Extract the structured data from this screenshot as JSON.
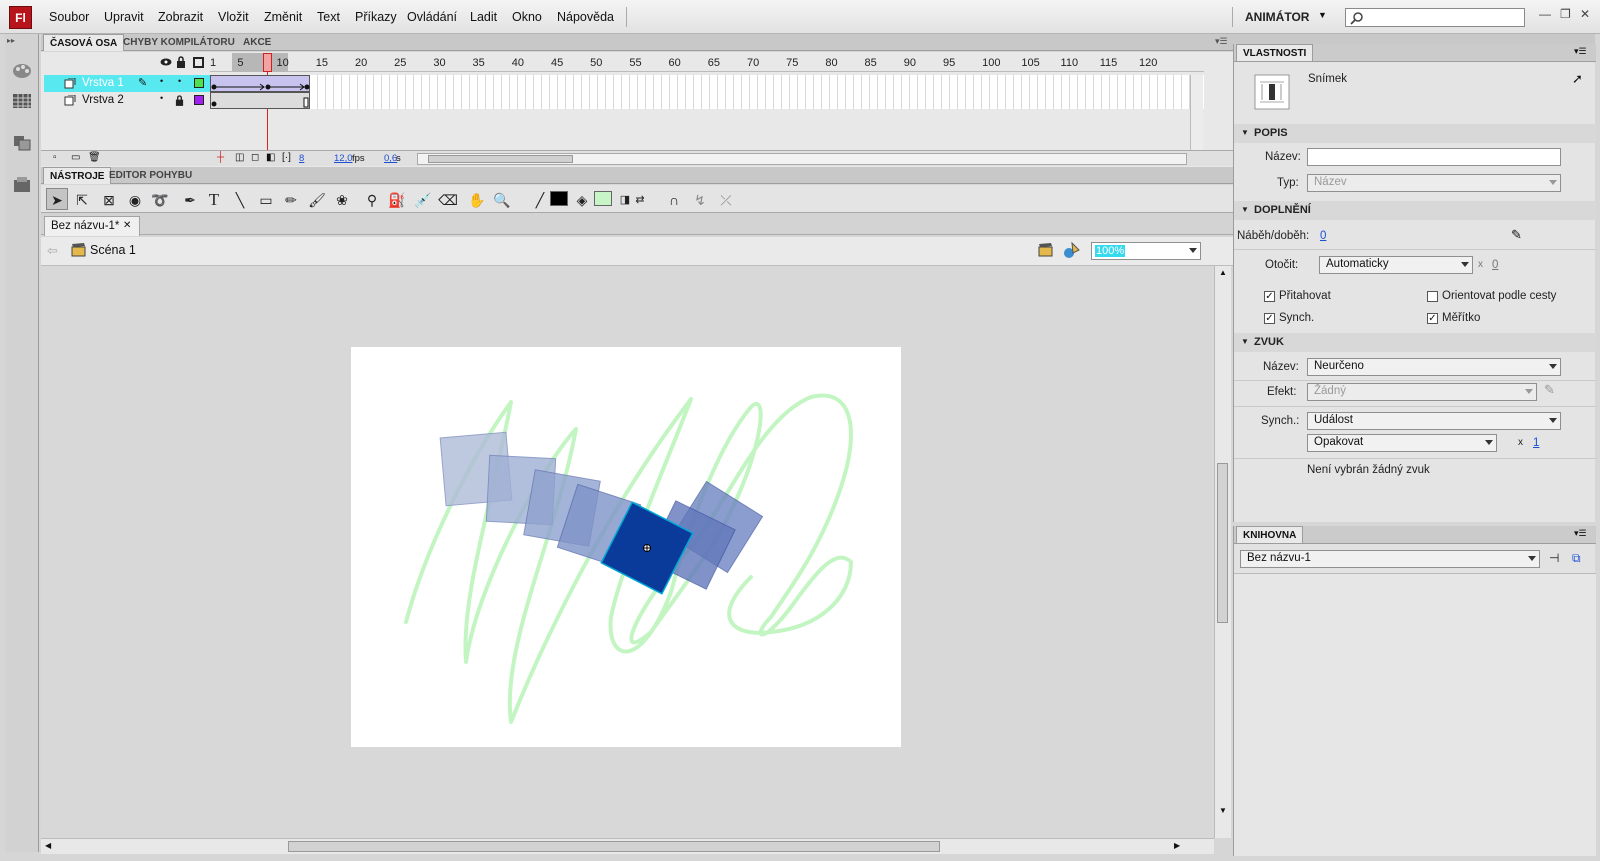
{
  "app": {
    "logo": "Fl"
  },
  "menu": [
    "Soubor",
    "Upravit",
    "Zobrazit",
    "Vložit",
    "Změnit",
    "Text",
    "Příkazy",
    "Ovládání",
    "Ladit",
    "Okno",
    "Nápověda"
  ],
  "workspace": {
    "label": "ANIMÁTOR",
    "search_placeholder": ""
  },
  "timeline": {
    "tabs": [
      "ČASOVÁ OSA",
      "CHYBY KOMPILÁTORU",
      "AKCE"
    ],
    "ruler": [
      "1",
      "5",
      "10",
      "15",
      "20",
      "25",
      "30",
      "35",
      "40",
      "45",
      "50",
      "55",
      "60",
      "65",
      "70",
      "75",
      "80",
      "85",
      "90",
      "95",
      "100",
      "105",
      "110",
      "115",
      "120"
    ],
    "layers": [
      {
        "name": "Vrstva 1",
        "selected": true,
        "color": "#4fe04f"
      },
      {
        "name": "Vrstva 2",
        "selected": false,
        "color": "#a020f0"
      }
    ],
    "current_frame": "8",
    "fps": "12,0",
    "fps_unit": "fps",
    "time": "0,6",
    "time_unit": "s"
  },
  "tools": {
    "tabs": [
      "NÁSTROJE",
      "EDITOR POHYBU"
    ]
  },
  "document": {
    "tab": "Bez názvu-1*",
    "scene": "Scéna 1",
    "zoom": "100%"
  },
  "properties": {
    "title": "VLASTNOSTI",
    "type_label": "Snímek",
    "popis": {
      "header": "POPIS",
      "name_label": "Název:",
      "name_value": "",
      "type_label": "Typ:",
      "type_value": "Název"
    },
    "doplneni": {
      "header": "DOPLNĚNÍ",
      "ease_label": "Náběh/doběh:",
      "ease_value": "0",
      "rotate_label": "Otočit:",
      "rotate_value": "Automaticky",
      "rotate_times_sep": "x",
      "rotate_times": "0",
      "snap_label": "Přitahovat",
      "orient_label": "Orientovat podle cesty",
      "sync_label": "Synch.",
      "scale_label": "Měřítko"
    },
    "zvuk": {
      "header": "ZVUK",
      "name_label": "Název:",
      "name_value": "Neurčeno",
      "effect_label": "Efekt:",
      "effect_value": "Žádný",
      "sync_label": "Synch.:",
      "sync_value": "Událost",
      "repeat_value": "Opakovat",
      "repeat_times_sep": "x",
      "repeat_times": "1",
      "status": "Není vybrán žádný zvuk"
    }
  },
  "library": {
    "title": "KNIHOVNA",
    "document": "Bez názvu-1"
  }
}
